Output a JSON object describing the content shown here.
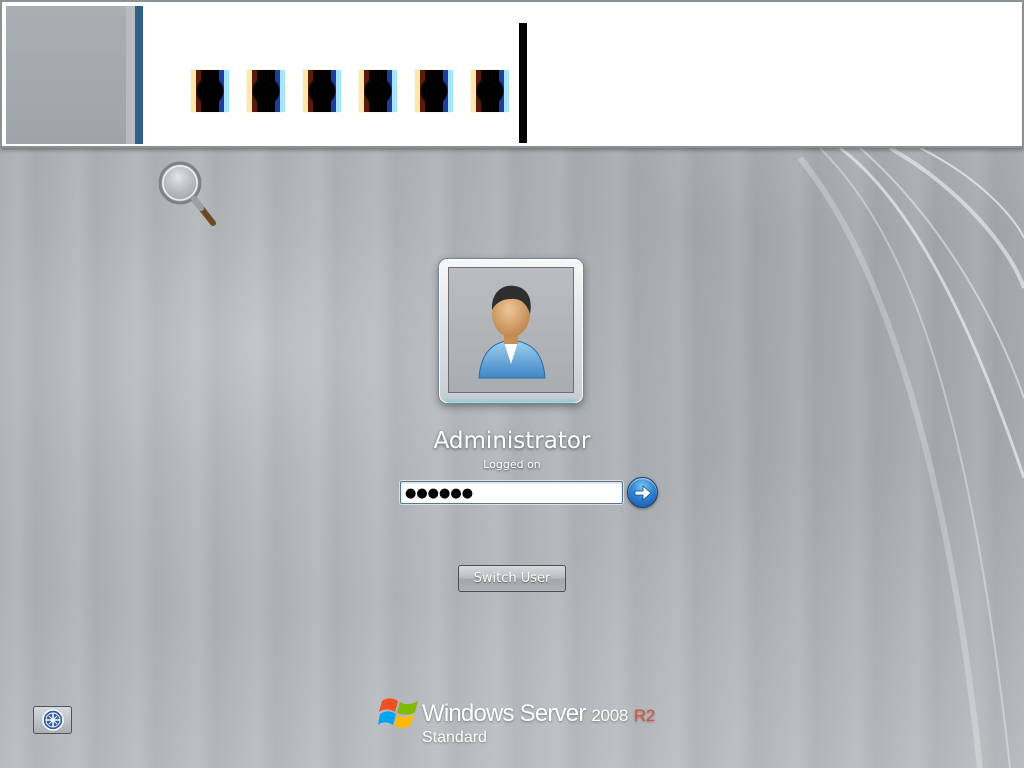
{
  "magnifier": {
    "masked_char_count": 6
  },
  "user": {
    "name": "Administrator",
    "status": "Logged on"
  },
  "password": {
    "value": "●●●●●●"
  },
  "buttons": {
    "switch_user_label": "Switch User"
  },
  "branding": {
    "product_name": "Windows Server",
    "version": "2008",
    "release": "R2",
    "edition": "Standard"
  },
  "icons": {
    "magnifier": "magnifier-icon",
    "user_avatar": "user-avatar-icon",
    "submit_arrow": "arrow-right-icon",
    "ease_of_access": "ease-of-access-icon",
    "windows_logo": "windows-logo-icon"
  },
  "colors": {
    "arrow_button": "#2f86d2",
    "release_accent": "#d8543a",
    "magnifier_separator": "#2f5f86"
  }
}
